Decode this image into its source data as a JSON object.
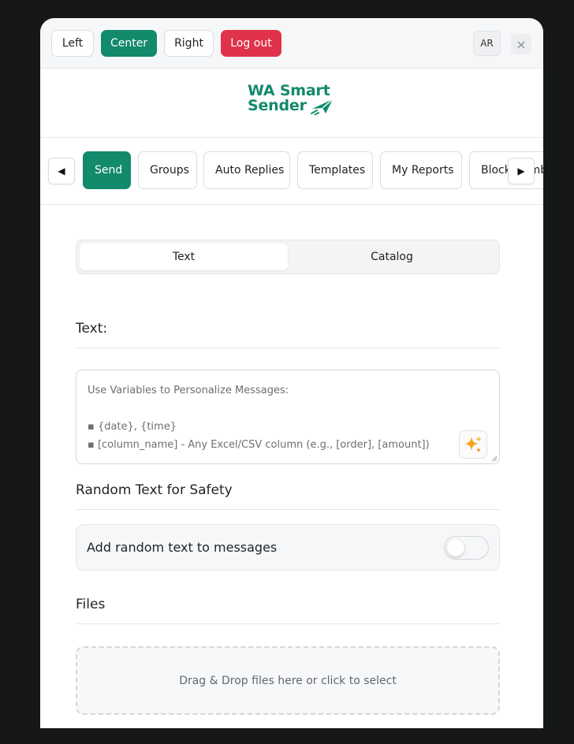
{
  "topbar": {
    "position_buttons": [
      {
        "label": "Left",
        "active": false
      },
      {
        "label": "Center",
        "active": true
      },
      {
        "label": "Right",
        "active": false
      }
    ],
    "logout_label": "Log out",
    "language_label": "AR",
    "close_label": "×"
  },
  "logo": {
    "line1": "WA Smart",
    "line2": "Sender",
    "icon": "paper-plane-icon"
  },
  "nav": {
    "prev_icon": "◀",
    "next_icon": "▶",
    "tabs": [
      {
        "label": "Send",
        "active": true
      },
      {
        "label": "Groups",
        "active": false
      },
      {
        "label": "Auto Replies",
        "active": false
      },
      {
        "label": "Templates",
        "active": false
      },
      {
        "label": "My Reports",
        "active": false
      },
      {
        "label": "Block Numbers",
        "active": false
      }
    ]
  },
  "mode_switch": {
    "options": [
      {
        "label": "Text",
        "active": true
      },
      {
        "label": "Catalog",
        "active": false
      }
    ]
  },
  "text_section": {
    "title": "Text:",
    "placeholder_lines": [
      "Use Variables to Personalize Messages:",
      "",
      "▪ {date}, {time}",
      "▪ [column_name] - Any Excel/CSV column (e.g., [order], [amount])"
    ],
    "ai_icon": "sparkles-icon"
  },
  "random_text": {
    "title": "Random Text for Safety",
    "toggle_label": "Add random text to messages",
    "enabled": false
  },
  "files": {
    "title": "Files",
    "dropzone_text": "Drag & Drop files here or click to select"
  },
  "colors": {
    "accent": "#128a6c",
    "danger": "#e0334b",
    "background": "#161818"
  }
}
